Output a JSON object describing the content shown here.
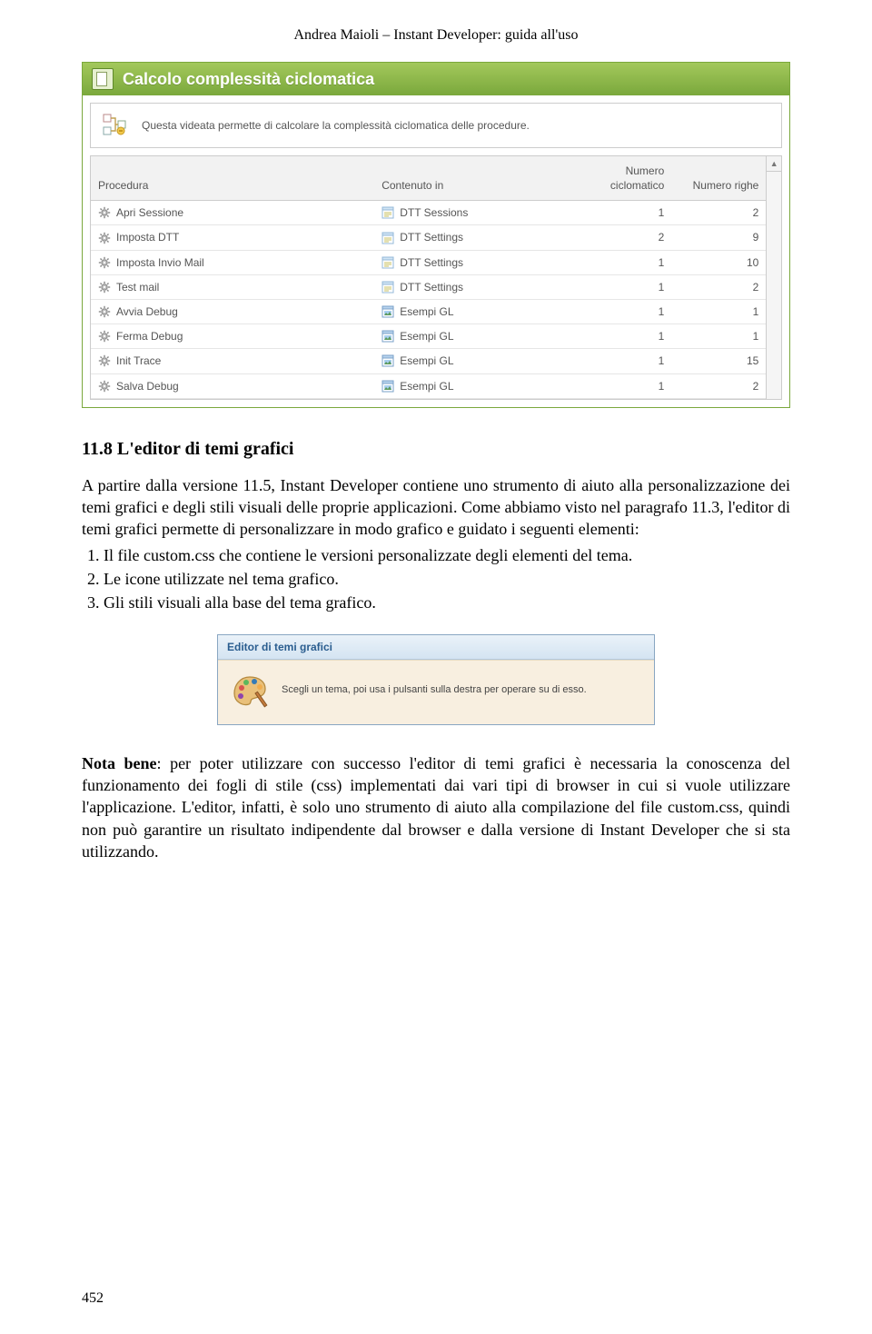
{
  "header": "Andrea Maioli – Instant Developer: guida all'uso",
  "page_number": "452",
  "app1": {
    "title": "Calcolo complessità ciclomatica",
    "description": "Questa videata permette di calcolare la complessità ciclomatica delle procedure.",
    "columns": {
      "procedura": "Procedura",
      "contenuto": "Contenuto in",
      "numero_ciclomatico": "Numero ciclomatico",
      "numero_righe": "Numero righe"
    },
    "rows": [
      {
        "procedura": "Apri Sessione",
        "contenuto": "DTT Sessions",
        "cont_type": "form",
        "nc": "1",
        "nr": "2"
      },
      {
        "procedura": "Imposta DTT",
        "contenuto": "DTT Settings",
        "cont_type": "form",
        "nc": "2",
        "nr": "9"
      },
      {
        "procedura": "Imposta Invio Mail",
        "contenuto": "DTT Settings",
        "cont_type": "form",
        "nc": "1",
        "nr": "10"
      },
      {
        "procedura": "Test mail",
        "contenuto": "DTT Settings",
        "cont_type": "form",
        "nc": "1",
        "nr": "2"
      },
      {
        "procedura": "Avvia Debug",
        "contenuto": "Esempi GL",
        "cont_type": "app",
        "nc": "1",
        "nr": "1"
      },
      {
        "procedura": "Ferma Debug",
        "contenuto": "Esempi GL",
        "cont_type": "app",
        "nc": "1",
        "nr": "1"
      },
      {
        "procedura": "Init Trace",
        "contenuto": "Esempi GL",
        "cont_type": "app",
        "nc": "1",
        "nr": "15"
      },
      {
        "procedura": "Salva Debug",
        "contenuto": "Esempi GL",
        "cont_type": "app",
        "nc": "1",
        "nr": "2"
      }
    ]
  },
  "section": {
    "heading": "11.8 L'editor di temi grafici",
    "para1": "A partire dalla versione 11.5, Instant Developer contiene uno strumento di aiuto alla personalizzazione dei temi grafici e degli stili visuali delle proprie applicazioni. Come abbiamo visto nel paragrafo 11.3, l'editor di temi grafici permette di personalizzare in modo grafico e guidato i seguenti elementi:",
    "items": [
      "Il file custom.css che contiene le versioni personalizzate degli elementi del tema.",
      "Le icone utilizzate nel tema grafico.",
      "Gli stili visuali alla base del tema grafico."
    ]
  },
  "editor_panel": {
    "title": "Editor di temi grafici",
    "text": "Scegli un tema, poi usa i pulsanti sulla destra per operare su di esso."
  },
  "nota_label": "Nota bene",
  "nota_body": ": per poter utilizzare con successo l'editor di temi grafici è necessaria la conoscenza del funzionamento dei fogli di stile (css) implementati dai vari tipi di browser in cui si vuole utilizzare l'applicazione. L'editor, infatti, è solo uno strumento di aiuto alla compilazione del file custom.css, quindi non può garantire un risultato indipendente dal browser e dalla versione di Instant Developer che si sta utilizzando."
}
